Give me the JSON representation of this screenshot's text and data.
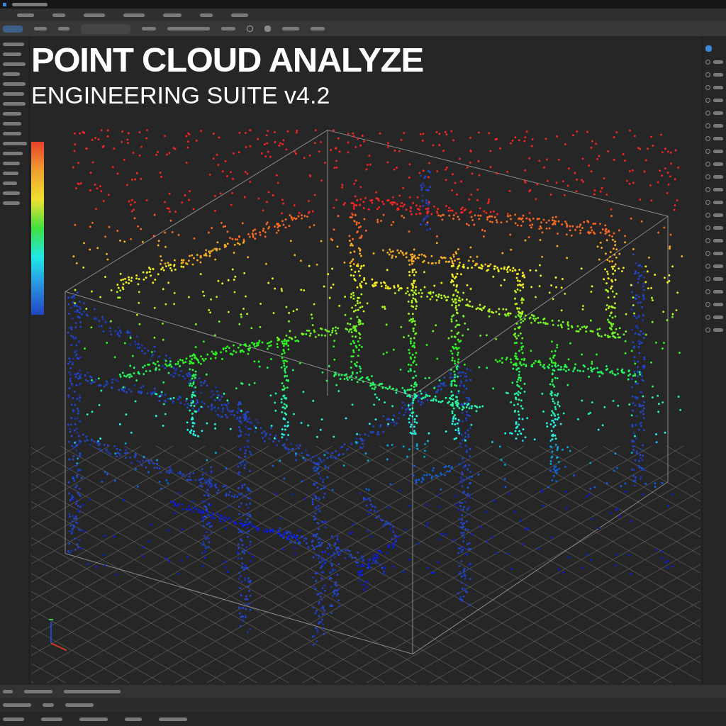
{
  "overlay_title": {
    "heading": "POINT CLOUD ANALYZE",
    "subheading": "ENGINEERING SUITE v4.2"
  }
}
